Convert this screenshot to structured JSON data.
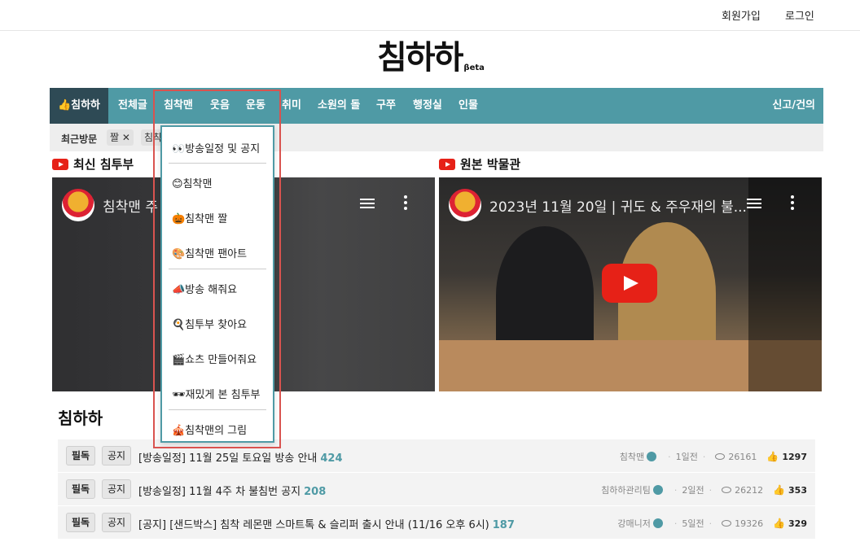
{
  "topbar": {
    "signup": "회원가입",
    "login": "로그인"
  },
  "logo": {
    "main": "침하하",
    "beta": "βeta"
  },
  "nav": {
    "home": "👍침하하",
    "items": [
      "전체글",
      "침착맨",
      "웃음",
      "운동",
      "취미",
      "소원의 돌",
      "구쭈",
      "행정실",
      "인물"
    ],
    "report": "신고/건의"
  },
  "recent": {
    "label": "최근방문",
    "chips": [
      "짤 ✕",
      "침착"
    ]
  },
  "sections": {
    "latest": "최신 침투부",
    "archive": "원본 박물관"
  },
  "videos": [
    {
      "title": "침착맨 주"
    },
    {
      "title": "2023년 11월 20일 | 귀도 & 주우재의 불..."
    }
  ],
  "dropdown": {
    "items": [
      "👀방송일정 및 공지",
      "😊침착맨",
      "🎃침착맨 짤",
      "🎨침착맨 팬아트",
      "📣방송 해줘요",
      "🍳침투부 찾아요",
      "🎬쇼츠 만들어줘요",
      "🕶재밌게 본 침투부",
      "🎪침착맨의 그림"
    ]
  },
  "board": {
    "title": "침하하",
    "posts": [
      {
        "pin": "필독",
        "tag": "공지",
        "title": "[방송일정] 11월 25일 토요일 방송 안내",
        "comments": "424",
        "author": "침착맨",
        "time": "1일전",
        "views": "26161",
        "likes": "1297"
      },
      {
        "pin": "필독",
        "tag": "공지",
        "title": "[방송일정] 11월 4주 차 불침번 공지",
        "comments": "208",
        "author": "침하하관리팀",
        "time": "2일전",
        "views": "26212",
        "likes": "353"
      },
      {
        "pin": "필독",
        "tag": "공지",
        "title": "[공지] [샌드박스] 침착 레몬맨 스마트톡 & 슬리퍼 출시 안내 (11/16 오후 6시)",
        "comments": "187",
        "author": "강매니저",
        "time": "5일전",
        "views": "19326",
        "likes": "329"
      }
    ]
  },
  "colors": {
    "nav": "#4f9aa5",
    "home": "#2e4a55",
    "highlight": "#d9534f"
  }
}
